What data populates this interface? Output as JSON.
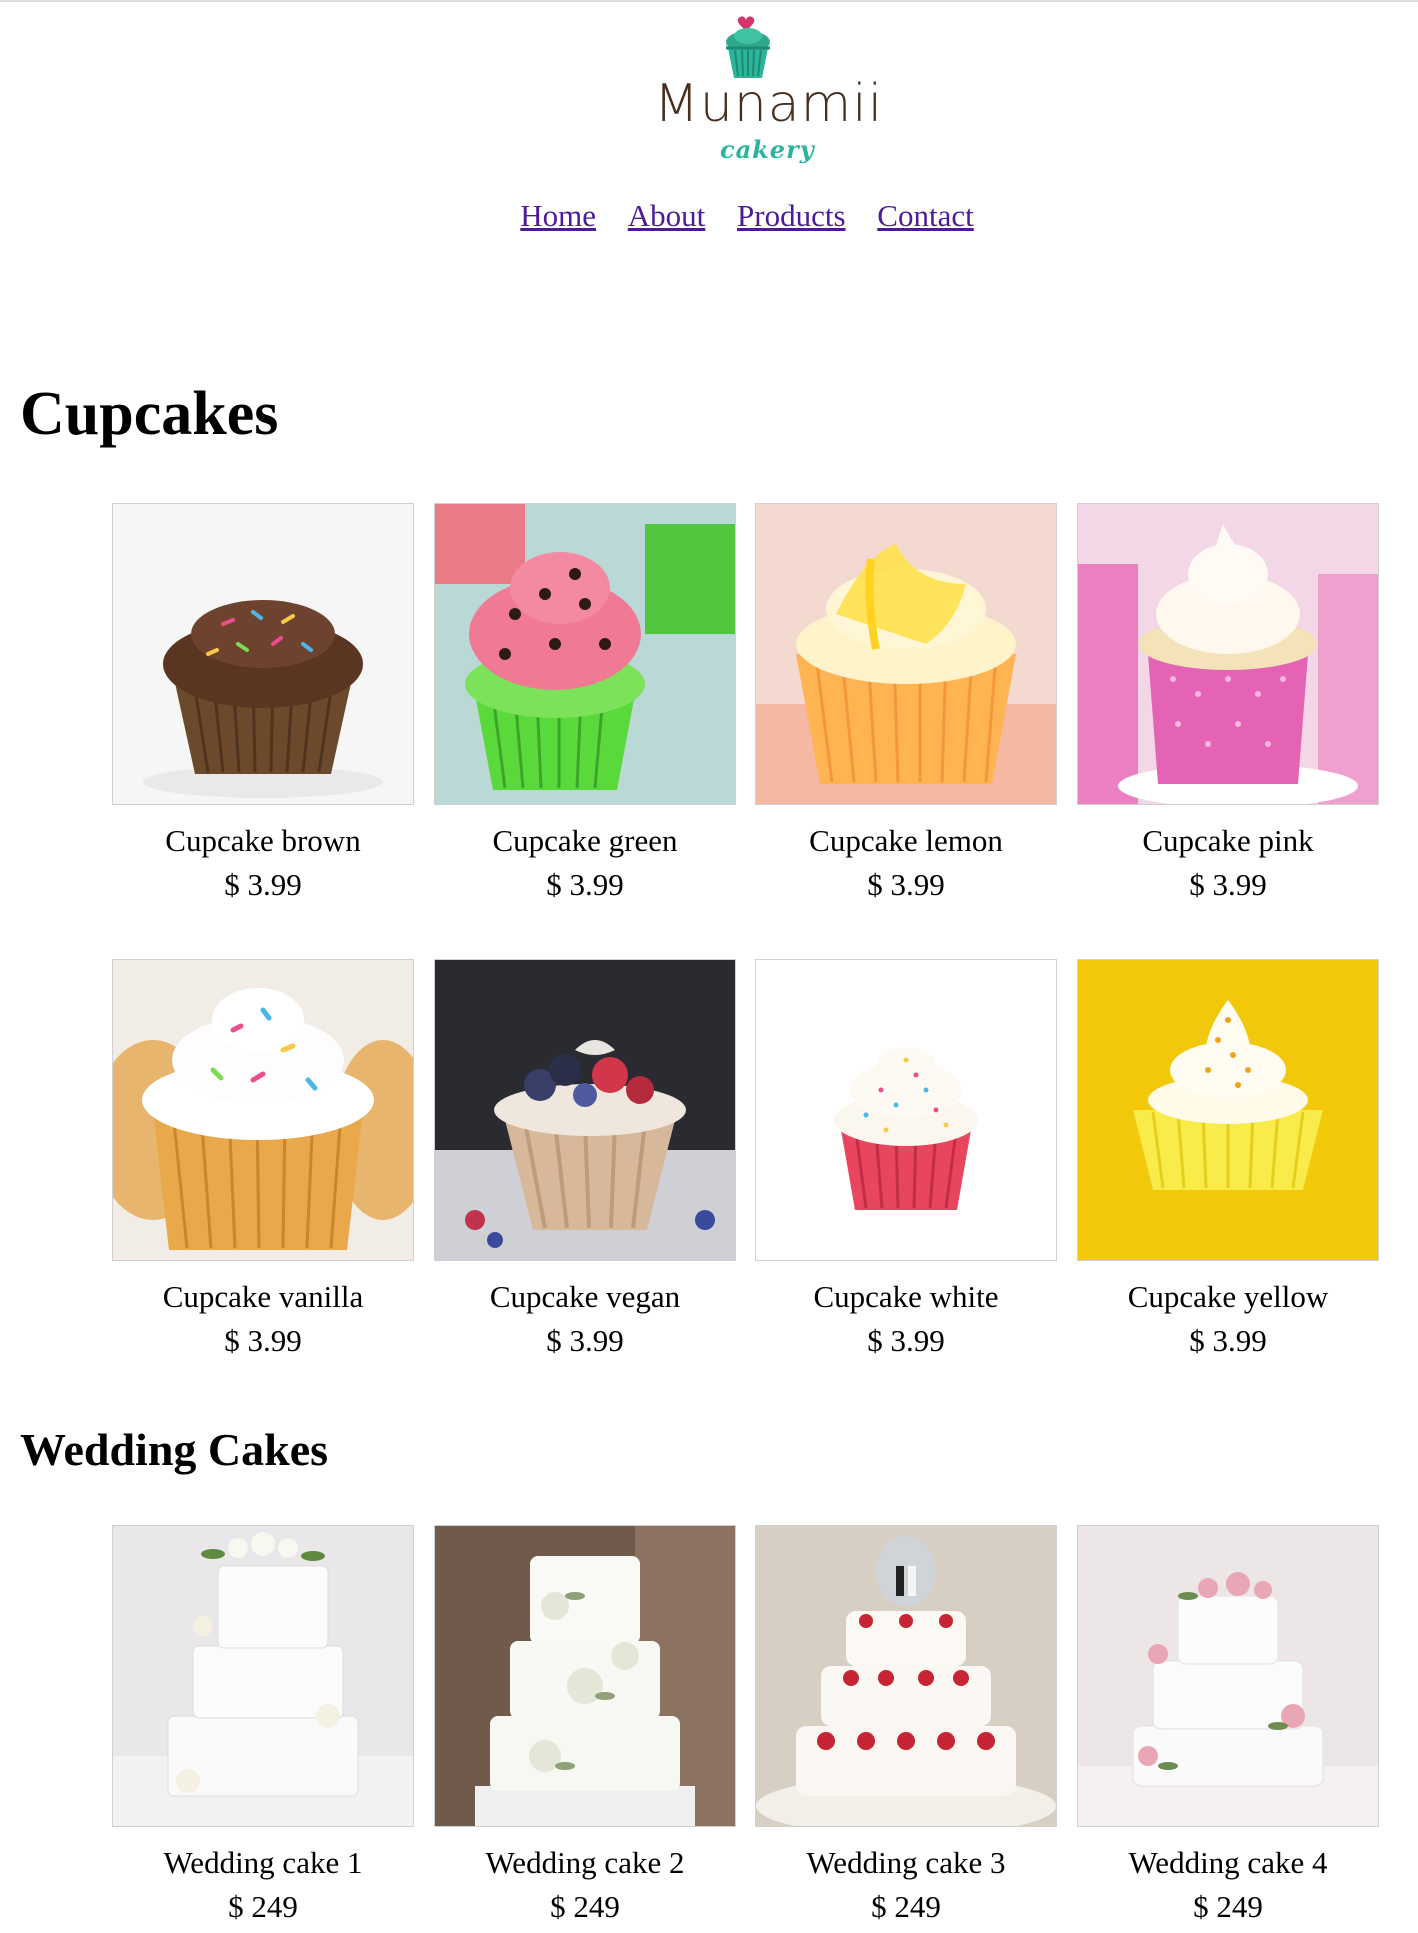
{
  "logo": {
    "name": "Munamii",
    "subtitle": "cakery"
  },
  "nav": {
    "items": [
      "Home",
      "About",
      "Products",
      "Contact"
    ]
  },
  "sections": {
    "cupcakes": {
      "title": "Cupcakes",
      "products": [
        {
          "name": "Cupcake brown",
          "price": "$ 3.99",
          "icon": "chocolate-cupcake-image"
        },
        {
          "name": "Cupcake green",
          "price": "$ 3.99",
          "icon": "watermelon-cupcake-image"
        },
        {
          "name": "Cupcake lemon",
          "price": "$ 3.99",
          "icon": "lemon-cupcake-image"
        },
        {
          "name": "Cupcake pink",
          "price": "$ 3.99",
          "icon": "pink-cupcake-image"
        },
        {
          "name": "Cupcake vanilla",
          "price": "$ 3.99",
          "icon": "vanilla-cupcake-image"
        },
        {
          "name": "Cupcake vegan",
          "price": "$ 3.99",
          "icon": "vegan-cupcake-image"
        },
        {
          "name": "Cupcake white",
          "price": "$ 3.99",
          "icon": "white-cupcake-image"
        },
        {
          "name": "Cupcake yellow",
          "price": "$ 3.99",
          "icon": "yellow-cupcake-image"
        }
      ]
    },
    "wedding": {
      "title": "Wedding Cakes",
      "products": [
        {
          "name": "Wedding cake 1",
          "price": "$ 249",
          "icon": "wedding-cake-image"
        },
        {
          "name": "Wedding cake 2",
          "price": "$ 249",
          "icon": "wedding-cake-image"
        },
        {
          "name": "Wedding cake 3",
          "price": "$ 249",
          "icon": "wedding-cake-image"
        },
        {
          "name": "Wedding cake 4",
          "price": "$ 249",
          "icon": "wedding-cake-image"
        }
      ]
    }
  },
  "colors": {
    "link": "#4b1b99",
    "logo_brown": "#4a2e1c",
    "logo_teal": "#2bb5a0"
  }
}
